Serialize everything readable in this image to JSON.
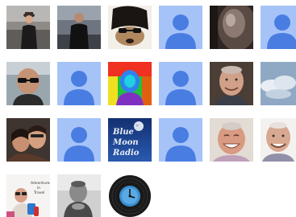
{
  "avatars": [
    {
      "row": 0,
      "col": 0,
      "kind": "photo",
      "icon": "man-in-hat-photo-icon",
      "label": ""
    },
    {
      "row": 0,
      "col": 1,
      "kind": "photo",
      "icon": "man-in-black-photo-icon",
      "label": ""
    },
    {
      "row": 0,
      "col": 2,
      "kind": "photo",
      "icon": "dog-with-sunglasses-photo-icon",
      "label": ""
    },
    {
      "row": 0,
      "col": 3,
      "kind": "default",
      "icon": "default-user-icon",
      "label": ""
    },
    {
      "row": 0,
      "col": 4,
      "kind": "photo",
      "icon": "dark-object-photo-icon",
      "label": ""
    },
    {
      "row": 0,
      "col": 5,
      "kind": "default",
      "icon": "default-user-icon",
      "label": ""
    },
    {
      "row": 1,
      "col": 0,
      "kind": "photo",
      "icon": "bald-man-sunglasses-photo-icon",
      "label": ""
    },
    {
      "row": 1,
      "col": 1,
      "kind": "default",
      "icon": "default-user-icon",
      "label": ""
    },
    {
      "row": 1,
      "col": 2,
      "kind": "photo",
      "icon": "thermal-portrait-photo-icon",
      "label": ""
    },
    {
      "row": 1,
      "col": 3,
      "kind": "default",
      "icon": "default-user-icon",
      "label": ""
    },
    {
      "row": 1,
      "col": 4,
      "kind": "photo",
      "icon": "smiling-man-photo-icon",
      "label": ""
    },
    {
      "row": 1,
      "col": 5,
      "kind": "photo",
      "icon": "cloudy-sky-photo-icon",
      "label": ""
    },
    {
      "row": 2,
      "col": 0,
      "kind": "photo",
      "icon": "couple-selfie-photo-icon",
      "label": ""
    },
    {
      "row": 2,
      "col": 1,
      "kind": "default",
      "icon": "default-user-icon",
      "label": ""
    },
    {
      "row": 2,
      "col": 2,
      "kind": "logo",
      "icon": "blue-moon-radio-logo-icon",
      "label": "Blue Moon Radio"
    },
    {
      "row": 2,
      "col": 3,
      "kind": "default",
      "icon": "default-user-icon",
      "label": ""
    },
    {
      "row": 2,
      "col": 4,
      "kind": "photo",
      "icon": "laughing-man-photo-icon",
      "label": ""
    },
    {
      "row": 2,
      "col": 5,
      "kind": "photo",
      "icon": "older-man-photo-icon",
      "label": ""
    },
    {
      "row": 3,
      "col": 0,
      "kind": "photo",
      "icon": "adventures-in-travel-photo-icon",
      "label": "Adventures in Travel"
    },
    {
      "row": 3,
      "col": 1,
      "kind": "photo",
      "icon": "bw-man-photo-icon",
      "label": ""
    },
    {
      "row": 3,
      "col": 2,
      "kind": "photo",
      "icon": "vinyl-record-clock-photo-icon",
      "label": ""
    }
  ],
  "colors": {
    "default_bg": "#a6c3f8",
    "default_figure": "#4a7de2"
  }
}
